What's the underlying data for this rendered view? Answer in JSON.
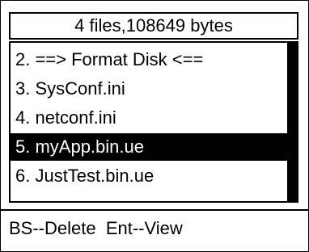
{
  "header": {
    "title": "4 files,108649 bytes"
  },
  "file_list": {
    "items": [
      {
        "label": "2. ==> Format Disk <==",
        "selected": false
      },
      {
        "label": "3. SysConf.ini",
        "selected": false
      },
      {
        "label": "4. netconf.ini",
        "selected": false
      },
      {
        "label": "5. myApp.bin.ue",
        "selected": true
      },
      {
        "label": "6. JustTest.bin.ue",
        "selected": false
      }
    ]
  },
  "footer": {
    "hint": "BS--Delete  Ent--View"
  },
  "colors": {
    "foreground": "#000000",
    "background": "#ffffff",
    "selection_bg": "#000000",
    "selection_fg": "#ffffff"
  }
}
